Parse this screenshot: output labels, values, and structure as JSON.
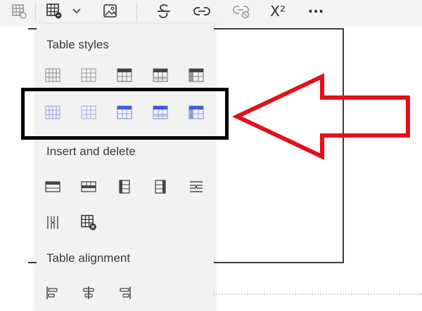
{
  "toolbar": {
    "buttons": [
      {
        "name": "table-options-icon"
      },
      {
        "name": "insert-table-icon"
      },
      {
        "name": "chevron-down-icon"
      },
      {
        "name": "insert-image-icon"
      },
      {
        "name": "strikethrough-icon"
      },
      {
        "name": "link-icon"
      },
      {
        "name": "unlink-icon"
      },
      {
        "name": "superscript-icon"
      },
      {
        "name": "more-options-icon"
      }
    ],
    "superscript_label": "X²",
    "more_label": "···"
  },
  "menu": {
    "table_styles_title": "Table styles",
    "insert_delete_title": "Insert and delete",
    "table_alignment_title": "Table alignment"
  },
  "colors": {
    "accent": "#3b5fd6",
    "highlight_border": "#000000",
    "arrow": "#e3101a",
    "panel_bg": "#f2f2f2"
  }
}
